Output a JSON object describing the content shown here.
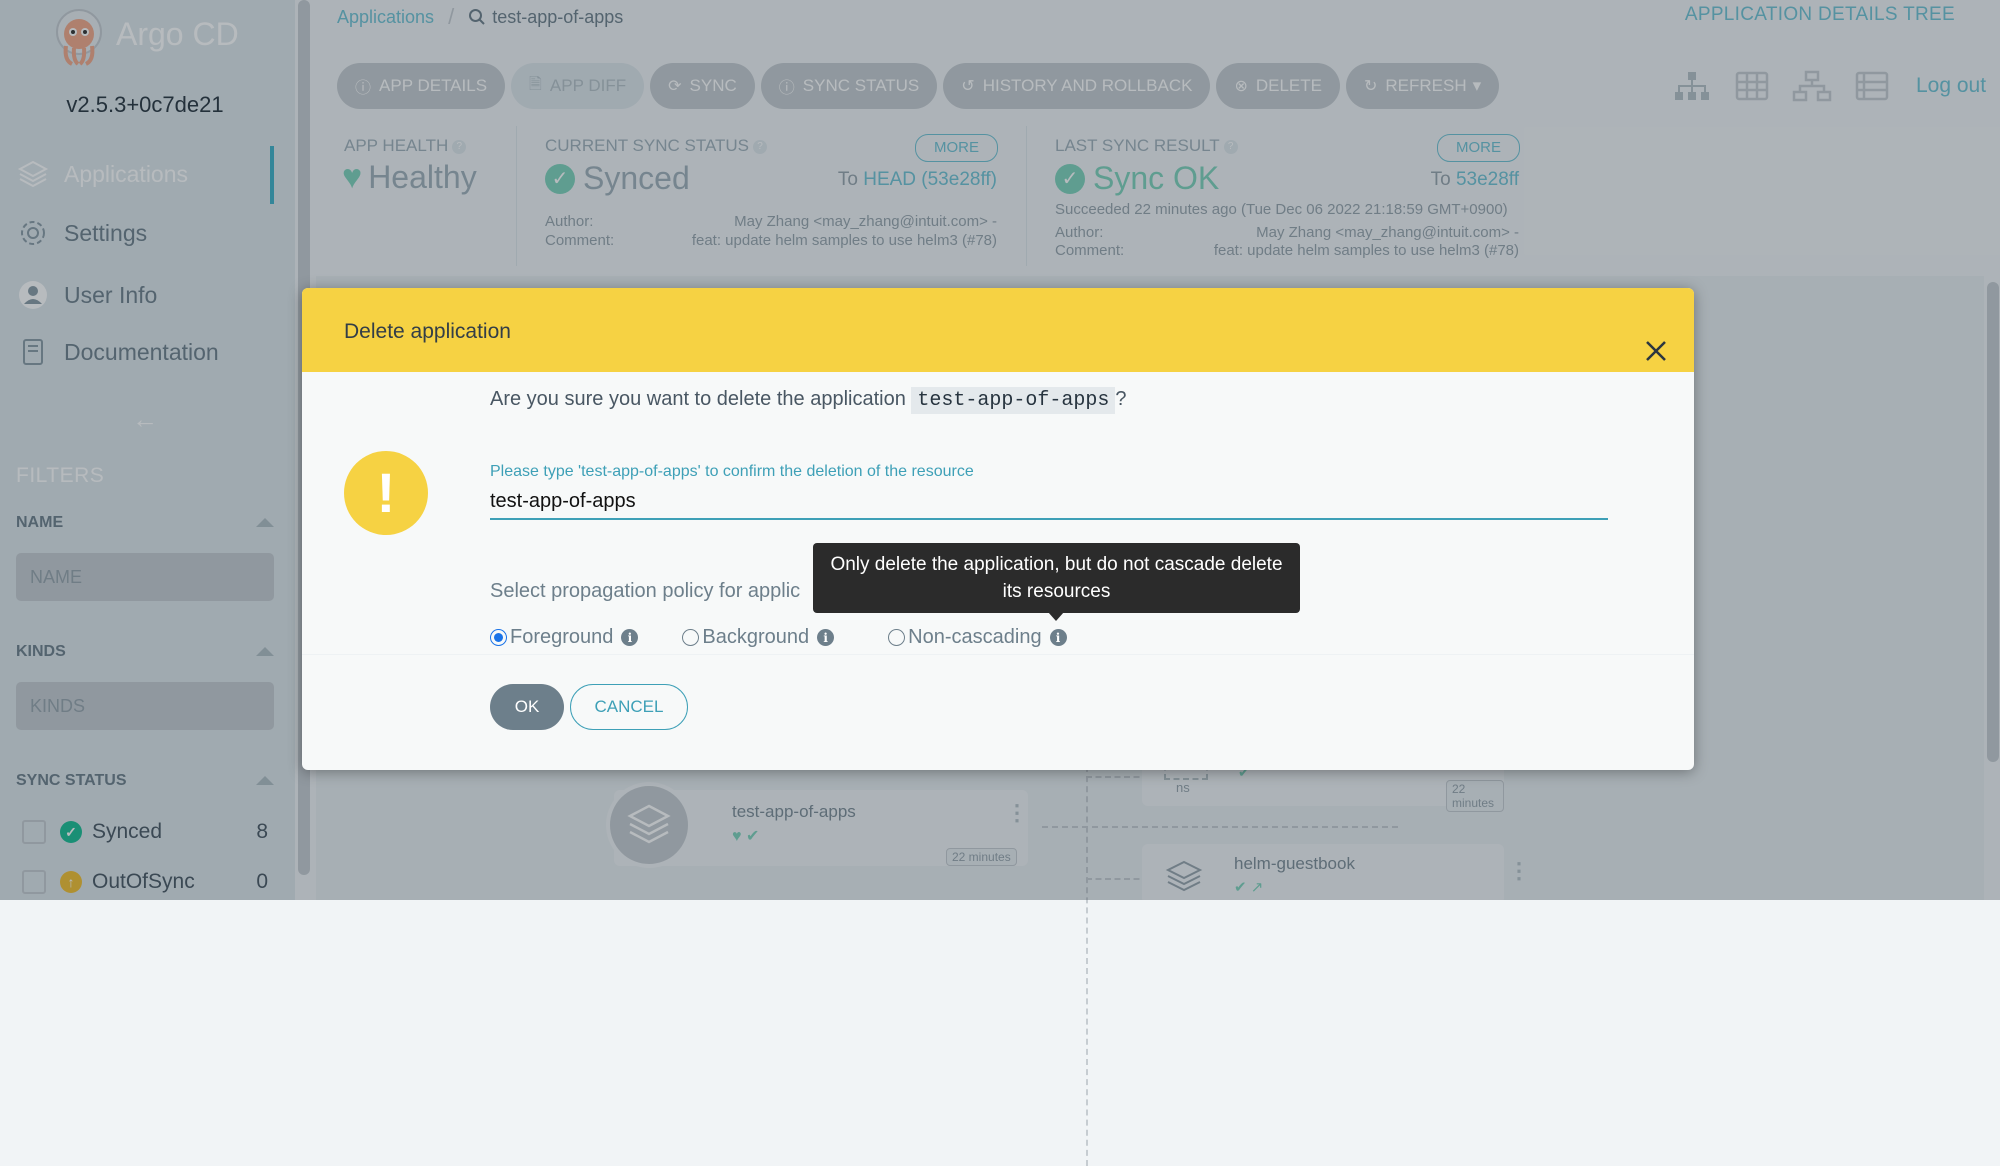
{
  "sidebar": {
    "app_name": "Argo CD",
    "version": "v2.5.3+0c7de21",
    "nav": [
      {
        "label": "Applications",
        "icon": "layers-icon",
        "active": true
      },
      {
        "label": "Settings",
        "icon": "gear-icon"
      },
      {
        "label": "User Info",
        "icon": "user-icon"
      },
      {
        "label": "Documentation",
        "icon": "book-icon"
      }
    ],
    "collapse_icon": "arrow-left-icon",
    "filters_title": "FILTERS",
    "name_filter": {
      "label": "NAME",
      "placeholder": "NAME"
    },
    "kinds_filter": {
      "label": "KINDS",
      "placeholder": "KINDS"
    },
    "sync_status": {
      "label": "SYNC STATUS",
      "items": [
        {
          "label": "Synced",
          "count": "8",
          "color": "#18be94"
        },
        {
          "label": "OutOfSync",
          "count": "0",
          "color": "#f4c030"
        }
      ]
    }
  },
  "header": {
    "breadcrumb_root": "Applications",
    "breadcrumb_current": "test-app-of-apps",
    "view_title": "APPLICATION DETAILS TREE",
    "toolbar": [
      {
        "label": "APP DETAILS",
        "icon": "info-icon"
      },
      {
        "label": "APP DIFF",
        "icon": "file-icon",
        "disabled": true
      },
      {
        "label": "SYNC",
        "icon": "sync-icon"
      },
      {
        "label": "SYNC STATUS",
        "icon": "info-icon"
      },
      {
        "label": "HISTORY AND ROLLBACK",
        "icon": "history-icon"
      },
      {
        "label": "DELETE",
        "icon": "close-circle-icon"
      },
      {
        "label": "REFRESH",
        "icon": "refresh-icon"
      }
    ],
    "logout": "Log out"
  },
  "status": {
    "app_health_label": "APP HEALTH",
    "app_health_value": "Healthy",
    "current_sync_label": "CURRENT SYNC STATUS",
    "current_sync_value": "Synced",
    "current_to_prefix": "To",
    "current_to_ref": "HEAD (53e28ff)",
    "more": "MORE",
    "author_label": "Author:",
    "comment_label": "Comment:",
    "current_author": "May Zhang <may_zhang@intuit.com> -",
    "current_comment": "feat: update helm samples to use helm3 (#78)",
    "last_sync_label": "LAST SYNC RESULT",
    "last_sync_value": "Sync OK",
    "last_to_prefix": "To",
    "last_to_ref": "53e28ff",
    "last_succeeded": "Succeeded 22 minutes ago (Tue Dec 06 2022 21:18:59 GMT+0900)",
    "last_author": "May Zhang <may_zhang@intuit.com> -",
    "last_comment": "feat: update helm samples to use helm3 (#78)",
    "healthy_color": "#18be94"
  },
  "graph": {
    "root_node": {
      "title": "test-app-of-apps",
      "time": "22 minutes"
    },
    "ns_node": {
      "kind": "ns",
      "time": "22 minutes"
    },
    "guestbook_node": {
      "title": "helm-guestbook"
    }
  },
  "dialog": {
    "title": "Delete application",
    "question_prefix": "Are you sure you want to delete the application",
    "question_app": "test-app-of-apps",
    "question_suffix": "?",
    "confirm_label": "Please type 'test-app-of-apps' to confirm the deletion of the resource",
    "confirm_value": "test-app-of-apps",
    "policy_label": "Select propagation policy for applic",
    "options": [
      "Foreground",
      "Background",
      "Non-cascading"
    ],
    "selected_option": "Foreground",
    "ok": "OK",
    "cancel": "CANCEL",
    "tooltip_line1": "Only delete the application, but do not cascade delete",
    "tooltip_line2": "its resources",
    "accent_color": "#f6d243"
  }
}
